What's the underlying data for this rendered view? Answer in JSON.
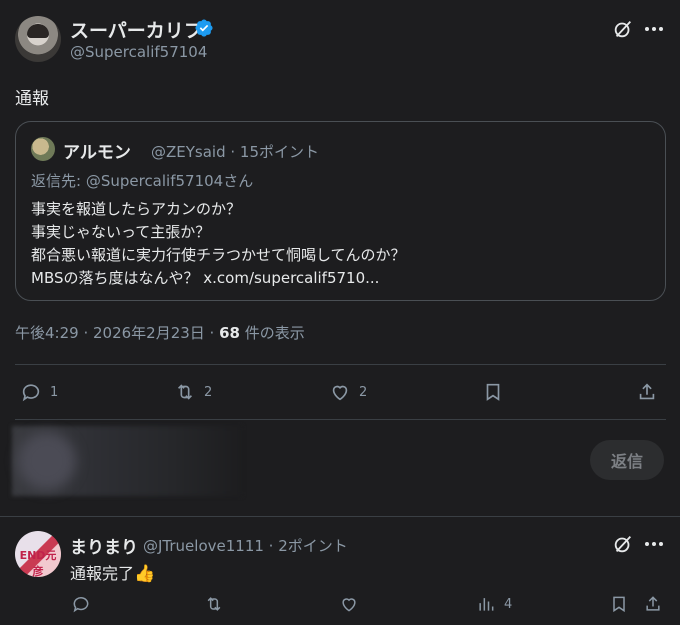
{
  "post": {
    "display_name": "スーパーカリフ",
    "handle": "@Supercalif57104",
    "text": "通報",
    "timestamp_prefix": "午後4:29 · 2026年2月23日 · ",
    "views_count": "68",
    "views_suffix": " 件の表示"
  },
  "quote": {
    "display_name": "アルモン",
    "meta": "@ZEYsaid · 15ポイント",
    "reply_to": "返信先: @Supercalif57104さん",
    "lines": [
      "事実を報道したらアカンのか？",
      "事実じゃないって主張か？",
      "都合悪い報道に実力行使チラつかせて恫喝してんのか？",
      "MBSの落ち度はなんや？ x.com/supercalif5710..."
    ]
  },
  "actions": {
    "replies": "1",
    "reposts": "2",
    "likes": "2"
  },
  "reply_composer": {
    "button_label": "返信"
  },
  "reply": {
    "display_name": "まりまり",
    "meta": "@JTruelove1111 · 2ポイント",
    "text": "通報完了",
    "emoji": "👍",
    "avatar_text": "END元彦",
    "views": "4"
  },
  "colors": {
    "background": "#1d1d1f",
    "text_primary": "#e7e9ea",
    "text_secondary": "#8b98a5",
    "verified": "#1d9bf0"
  },
  "icons": [
    "verified-badge-icon",
    "grok-icon",
    "more-icon",
    "reply-icon",
    "repost-icon",
    "like-icon",
    "bookmark-icon",
    "share-icon",
    "views-icon"
  ]
}
